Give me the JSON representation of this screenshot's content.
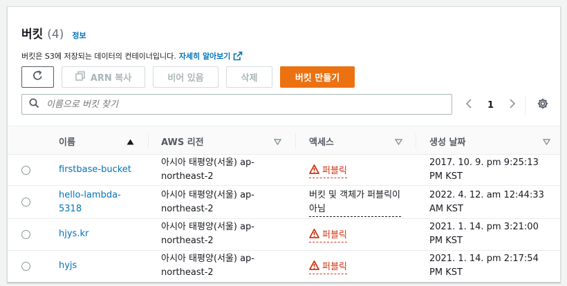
{
  "header": {
    "title": "버킷",
    "count": "(4)",
    "info": "정보",
    "description": "버킷은 S3에 저장되는 데이터의 컨테이너입니다.",
    "learn_more": "자세히 알아보기"
  },
  "toolbar": {
    "arn_copy": "ARN 복사",
    "empty": "비어 있음",
    "delete": "삭제",
    "create": "버킷 만들기"
  },
  "search": {
    "placeholder": "이름으로 버킷 찾기"
  },
  "pagination": {
    "page": "1"
  },
  "table": {
    "columns": {
      "name": "이름",
      "region": "AWS 리전",
      "access": "액세스",
      "created": "생성 날짜"
    },
    "rows": [
      {
        "name": "firstbase-bucket",
        "region_1": "아시아 태평양(서울) ap-",
        "region_2": "northeast-2",
        "access": "퍼블릭",
        "public": true,
        "created_1": "2017. 10. 9. pm 9:25:13",
        "created_2": "PM KST"
      },
      {
        "name_1": "hello-lambda-",
        "name_2": "5318",
        "region_1": "아시아 태평양(서울) ap-",
        "region_2": "northeast-2",
        "access_1": "버킷 및 객체가 퍼블릭이",
        "access_2": "아님",
        "public": false,
        "created_1": "2022. 4. 12. am 12:44:33",
        "created_2": "AM KST"
      },
      {
        "name": "hjys.kr",
        "region_1": "아시아 태평양(서울) ap-",
        "region_2": "northeast-2",
        "access": "퍼블릭",
        "public": true,
        "created_1": "2021. 1. 14. pm 3:21:00",
        "created_2": "PM KST"
      },
      {
        "name": "hyjs",
        "region_1": "아시아 태평양(서울) ap-",
        "region_2": "northeast-2",
        "access": "퍼블릭",
        "public": true,
        "created_1": "2021. 1. 14. pm 2:17:54",
        "created_2": "PM KST"
      }
    ]
  },
  "colors": {
    "link": "#0073bb",
    "primary": "#ec7211",
    "public_warning": "#d13212"
  },
  "icons": [
    "refresh-icon",
    "copy-icon",
    "external-link-icon",
    "search-icon",
    "chevron-left-icon",
    "chevron-right-icon",
    "settings-gear-icon",
    "sort-ascending-icon",
    "sort-icon",
    "warning-icon"
  ]
}
